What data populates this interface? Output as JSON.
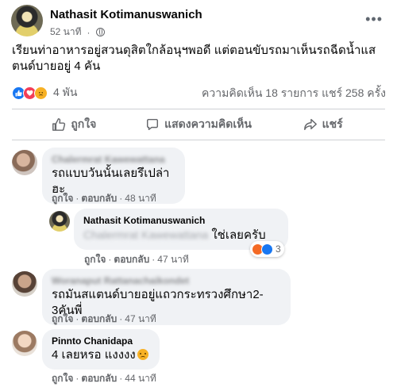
{
  "post": {
    "author": "Nathasit Kotimanuswanich",
    "time": "52 นาที",
    "text": "เรียนท่าอาหารอยู่สวนดุสิตใกล้อนุฯพอดี แต่ตอนขับรถมาเห็นรถฉีดน้ำแสตนด์บายอยู่ 4 คัน",
    "reaction_count": "4 พัน",
    "stats": "ความคิดเห็น 18 รายการ  แชร์ 258 ครั้ง",
    "colors": {
      "accent": "#1877f2",
      "love": "#f33e58",
      "sad": "#f7b125",
      "muted": "#65676b"
    }
  },
  "actions": {
    "like": "ถูกใจ",
    "comment": "แสดงความคิดเห็น",
    "share": "แชร์"
  },
  "comments": [
    {
      "name": "Chalermrat Kawewattana",
      "text": "รถแบบวันนั้นเลยรึเปล่าฮะ",
      "like": "ถูกใจ",
      "reply": "ตอบกลับ",
      "time": "48 นาที",
      "replies": [
        {
          "name": "Nathasit Kotimanuswanich",
          "mention": "Chalermrat Kawewattana",
          "text": "ใช่เลยครับ",
          "reaction_count": "3",
          "like": "ถูกใจ",
          "reply": "ตอบกลับ",
          "time": "47 นาที"
        }
      ]
    },
    {
      "name": "Woranaput Rattanachaikondet",
      "text": "รถมันสแตนด์บายอยู่แถวกระทรวงศึกษา2-3คันพี่",
      "like": "ถูกใจ",
      "reply": "ตอบกลับ",
      "time": "47 นาที"
    },
    {
      "name": "Pinnto Chanidapa",
      "text": "4 เลยหรอ แงงงง",
      "like": "ถูกใจ",
      "reply": "ตอบกลับ",
      "time": "44 นาที"
    }
  ]
}
